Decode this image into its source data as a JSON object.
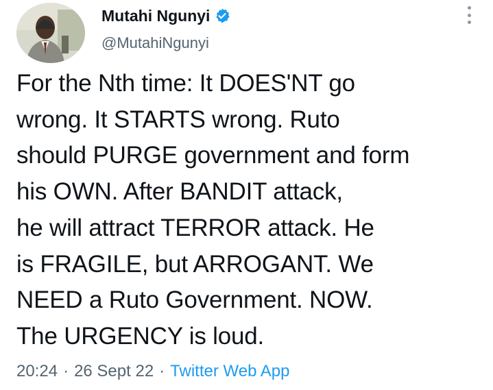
{
  "author": {
    "display_name": "Mutahi Ngunyi",
    "handle": "@MutahiNgunyi",
    "verified": true,
    "verified_color": "#1d9bf0"
  },
  "tweet": {
    "lines": [
      "For the Nth time: It DOES'NT go",
      "wrong. It STARTS wrong. Ruto",
      "should PURGE government and form",
      "his OWN. After BANDIT attack,",
      "he will attract TERROR attack. He",
      "is FRAGILE, but ARROGANT. We",
      "NEED a Ruto Government. NOW.",
      "The URGENCY is loud."
    ]
  },
  "meta": {
    "time": "20:24",
    "separator": "·",
    "date": "26 Sept 22",
    "source": "Twitter Web App"
  },
  "icons": {
    "verified": "verified-badge-icon",
    "more": "more-vertical-icon"
  },
  "colors": {
    "text": "#0f1419",
    "secondary": "#536471",
    "link": "#1d9bf0"
  }
}
